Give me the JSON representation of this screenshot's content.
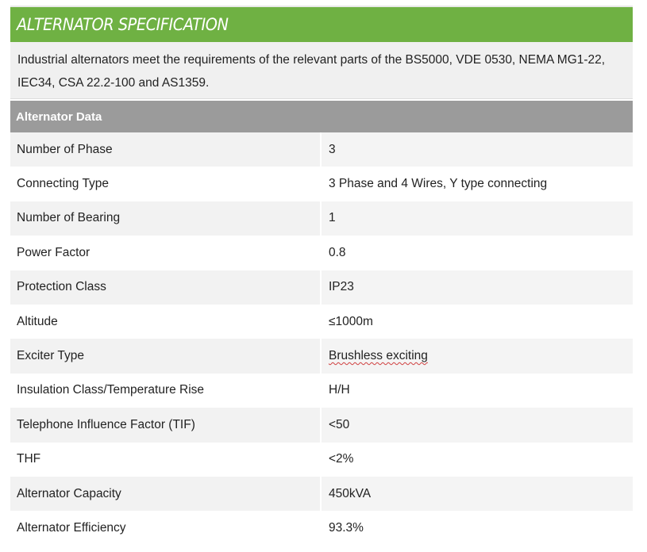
{
  "banner": {
    "title": "ALTERNATOR SPECIFICATION"
  },
  "intro": {
    "text": "Industrial alternators meet the requirements of the relevant parts of the BS5000, VDE 0530, NEMA MG1-22, IEC34, CSA 22.2-100 and AS1359."
  },
  "section": {
    "title": "Alternator Data"
  },
  "rows": [
    {
      "label": "Number of Phase",
      "value": "3"
    },
    {
      "label": "Connecting Type",
      "value": "3 Phase and 4 Wires, Y type connecting"
    },
    {
      "label": "Number of Bearing",
      "value": "1"
    },
    {
      "label": "Power Factor",
      "value": "0.8"
    },
    {
      "label": "Protection Class",
      "value": "IP23"
    },
    {
      "label": "Altitude",
      "value": "≤1000m"
    },
    {
      "label": "Exciter Type",
      "value": "Brushless exciting"
    },
    {
      "label": "Insulation Class/Temperature Rise",
      "value": "H/H"
    },
    {
      "label": "Telephone Influence Factor (TIF)",
      "value": "<50"
    },
    {
      "label": "THF",
      "value": "<2%"
    },
    {
      "label": "Alternator Capacity",
      "value": "450kVA"
    },
    {
      "label": "Alternator Efficiency",
      "value": "93.3%"
    }
  ],
  "colors": {
    "banner_green": "#6fb143",
    "section_gray": "#9b9b9b",
    "row_shade": "#f2f2f2"
  }
}
